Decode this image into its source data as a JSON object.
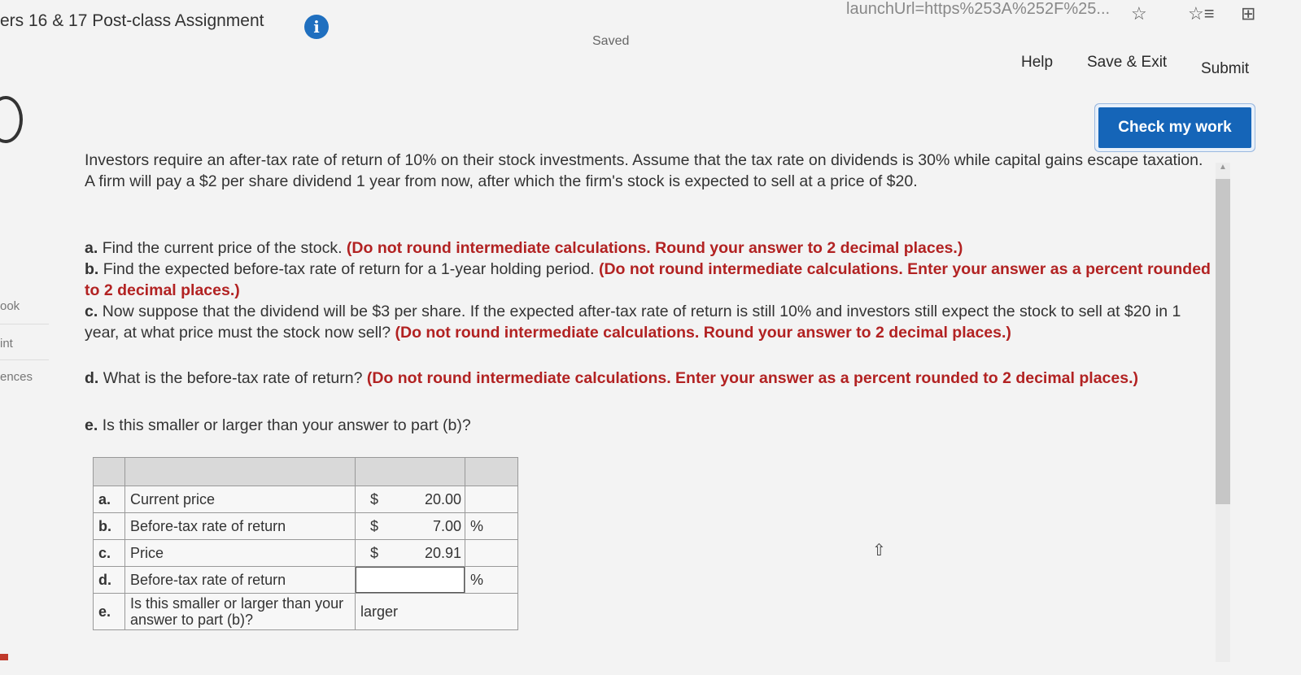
{
  "header": {
    "title": "ers 16 & 17 Post-class Assignment",
    "url_fragment": "launchUrl=https%253A%252F%25...",
    "saved": "Saved",
    "help": "Help",
    "save_exit": "Save & Exit",
    "submit": "Submit",
    "check_work": "Check my work"
  },
  "sidebar": {
    "items": [
      "ook",
      "int",
      "ences"
    ]
  },
  "question": {
    "intro": "Investors require an after-tax rate of return of 10% on their stock investments. Assume that the tax rate on dividends is 30% while capital gains escape taxation. A firm will pay a $2 per share dividend 1 year from now, after which the firm's stock is expected to sell at a price of $20.",
    "parts": [
      {
        "label": "a.",
        "text": "Find the current price of the stock.",
        "note": "(Do not round intermediate calculations. Round your answer to 2 decimal places.)"
      },
      {
        "label": "b.",
        "text": "Find the expected before-tax rate of return for a 1-year holding period.",
        "note": "(Do not round intermediate calculations. Enter your answer as a percent rounded to 2 decimal places.)"
      },
      {
        "label": "c.",
        "text": "Now suppose that the dividend will be $3 per share. If the expected after-tax rate of return is still 10% and investors still expect the stock to sell at $20 in 1 year, at what price must the stock now sell?",
        "note": "(Do not round intermediate calculations. Round your answer to 2 decimal places.)"
      },
      {
        "label": "d.",
        "text": "What is the before-tax rate of return?",
        "note": "(Do not round intermediate calculations. Enter your answer as a percent rounded to 2 decimal places.)"
      },
      {
        "label": "e.",
        "text": "Is this smaller or larger than your answer to part (b)?",
        "note": ""
      }
    ]
  },
  "table": {
    "rows": [
      {
        "label": "a.",
        "desc": "Current price",
        "currency": "$",
        "value": "20.00",
        "unit": ""
      },
      {
        "label": "b.",
        "desc": "Before-tax rate of return",
        "currency": "$",
        "value": "7.00",
        "unit": "%"
      },
      {
        "label": "c.",
        "desc": "Price",
        "currency": "$",
        "value": "20.91",
        "unit": ""
      },
      {
        "label": "d.",
        "desc": "Before-tax rate of return",
        "currency": "",
        "value": "",
        "unit": "%"
      },
      {
        "label": "e.",
        "desc": "Is this smaller or larger than your answer to part (b)?",
        "currency": "",
        "value": "larger",
        "unit": ""
      }
    ]
  },
  "icons": {
    "info": "info-icon",
    "favorite_add": "star-plus-icon",
    "favorites": "favorites-list-icon",
    "collections": "collections-icon",
    "cursor": "mouse-cursor-icon"
  },
  "colors": {
    "accent": "#1565b8",
    "note_red": "#b22222"
  }
}
